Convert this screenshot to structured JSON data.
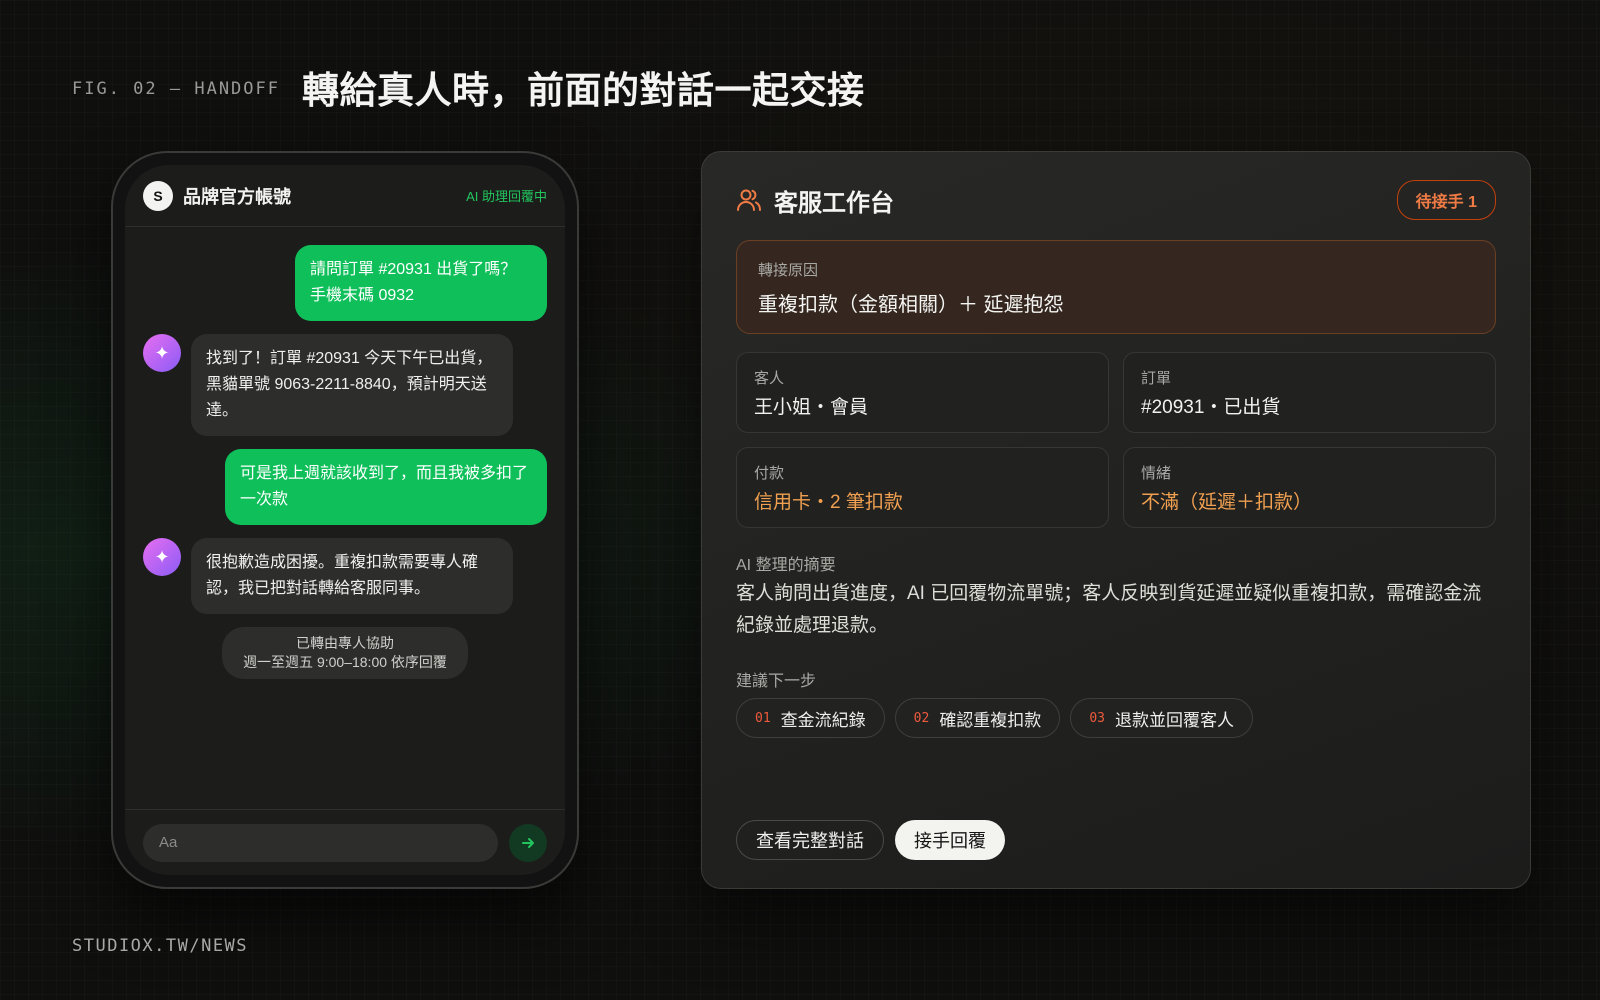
{
  "figure": {
    "label": "FIG. 02 — HANDOFF",
    "title": "轉給真人時，前面的對話一起交接",
    "footer": "STUDIOX.TW/NEWS"
  },
  "chat": {
    "avatar_letter": "S",
    "brand_name": "品牌官方帳號",
    "ai_status": "AI 助理回覆中",
    "messages": [
      {
        "role": "user",
        "text": "請問訂單 #20931 出貨了嗎？手機末碼 0932"
      },
      {
        "role": "bot",
        "text": "找到了！訂單 #20931 今天下午已出貨，黑貓單號 9063-2211-8840，預計明天送達。"
      },
      {
        "role": "user",
        "text": "可是我上週就該收到了，而且我被多扣了一次款"
      },
      {
        "role": "bot",
        "text": "很抱歉造成困擾。重複扣款需要專人確認，我已把對話轉給客服同事。"
      }
    ],
    "handoff_note": {
      "line1": "已轉由專人協助",
      "line2": "週一至週五 9:00–18:00 依序回覆"
    },
    "composer_placeholder": "Aa",
    "icons": {
      "bot_avatar": "sparkle-icon",
      "send": "arrow-right-icon"
    }
  },
  "workbench": {
    "title": "客服工作台",
    "title_icon": "users-icon",
    "pending_badge": "待接手 1",
    "reason": {
      "label": "轉接原因",
      "value": "重複扣款（金額相關）＋ 延遲抱怨"
    },
    "info": {
      "customer": {
        "label": "客人",
        "value": "王小姐・會員"
      },
      "order": {
        "label": "訂單",
        "value": "#20931・已出貨"
      },
      "payment": {
        "label": "付款",
        "value": "信用卡・2 筆扣款"
      },
      "mood": {
        "label": "情緒",
        "value": "不滿（延遲＋扣款）"
      }
    },
    "summary": {
      "label": "AI 整理的摘要",
      "text": "客人詢問出貨進度，AI 已回覆物流單號；客人反映到貨延遲並疑似重複扣款，需確認金流紀錄並處理退款。"
    },
    "next_steps": {
      "label": "建議下一步",
      "items": [
        {
          "num": "01",
          "label": "查金流紀錄"
        },
        {
          "num": "02",
          "label": "確認重複扣款"
        },
        {
          "num": "03",
          "label": "退款並回覆客人"
        }
      ]
    },
    "actions": {
      "view_full": "查看完整對話",
      "take_over": "接手回覆"
    }
  },
  "colors": {
    "user_bubble": "#0fbf5a",
    "ai_status": "#22c55e",
    "accent_orange": "#f07b45",
    "warning_value": "#f0a050"
  }
}
